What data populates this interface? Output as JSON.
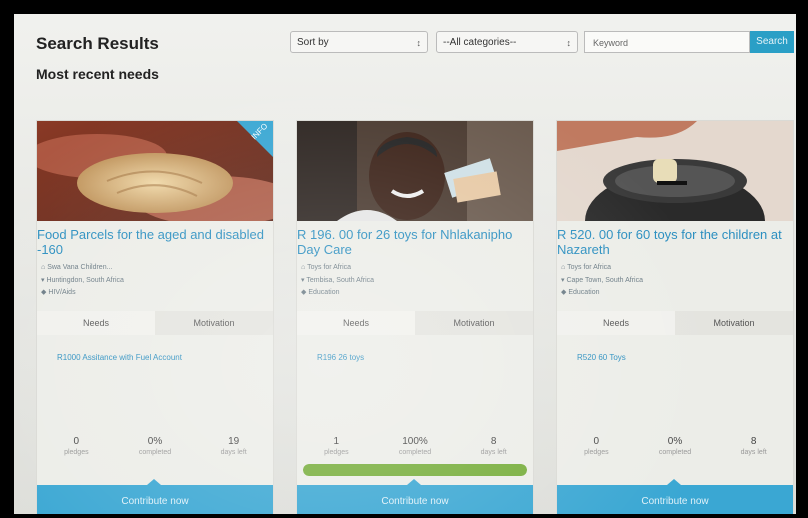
{
  "header": {
    "title": "Search Results",
    "subtitle": "Most recent needs"
  },
  "filters": {
    "sort_label": "Sort by",
    "category_label": "--All categories--",
    "keyword_placeholder": "Keyword",
    "search_label": "Search"
  },
  "cards": [
    {
      "heading": "Food Parcels for the aged and disabled -160",
      "badge": "INFO",
      "org": "Swa Vana Children...",
      "location": "Huntingdon, South Africa",
      "category": "HIV/Aids",
      "tab_needs": "Needs",
      "tab_motivation": "Motivation",
      "need_item": "R1000 Assitance with Fuel Account",
      "pledges_value": "0",
      "pledges_label": "pledges",
      "completed_value": "0%",
      "completed_label": "completed",
      "days_value": "19",
      "days_label": "days left",
      "progress": 0,
      "contribute_label": "Contribute now"
    },
    {
      "heading": "R 196. 00 for 26 toys for Nhlakanipho Day Care",
      "org": "Toys for Africa",
      "location": "Tembisa, South Africa",
      "category": "Education",
      "tab_needs": "Needs",
      "tab_motivation": "Motivation",
      "need_item": "R196 26 toys",
      "pledges_value": "1",
      "pledges_label": "pledges",
      "completed_value": "100%",
      "completed_label": "completed",
      "days_value": "8",
      "days_label": "days left",
      "progress": 1.0,
      "contribute_label": "Contribute now"
    },
    {
      "heading": "R 520. 00 for 60 toys for the children at Nazareth",
      "org": "Toys for Africa",
      "location": "Cape Town, South Africa",
      "category": "Education",
      "tab_needs": "Needs",
      "tab_motivation": "Motivation",
      "need_item": "R520 60 Toys",
      "pledges_value": "0",
      "pledges_label": "pledges",
      "completed_value": "0%",
      "completed_label": "completed",
      "days_value": "8",
      "days_label": "days left",
      "progress": 0,
      "contribute_label": "Contribute now"
    }
  ],
  "colors": {
    "accent": "#2a9fc6",
    "link": "#2b8fc0",
    "progress": "#76ad3a"
  }
}
